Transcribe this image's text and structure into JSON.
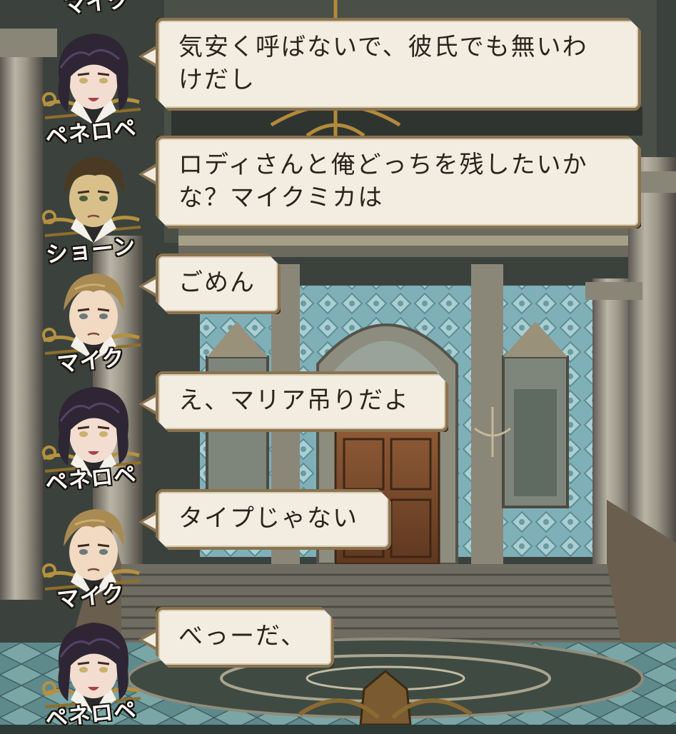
{
  "top_partial_name": "マイク",
  "messages": [
    {
      "speaker": "ペネロペ",
      "character": "penelope",
      "text_lines": [
        "気安く呼ばないで、彼氏でも無いわ",
        "けだし"
      ]
    },
    {
      "speaker": "ショーン",
      "character": "sean",
      "text_lines": [
        "ロディさんと俺どっちを残したいか",
        "な？マイクミカは"
      ]
    },
    {
      "speaker": "マイク",
      "character": "mike",
      "text_lines": [
        "ごめん"
      ]
    },
    {
      "speaker": "ペネロペ",
      "character": "penelope",
      "text_lines": [
        "え、マリア吊りだよ"
      ]
    },
    {
      "speaker": "マイク",
      "character": "mike",
      "text_lines": [
        "タイプじゃない"
      ]
    },
    {
      "speaker": "ペネロペ",
      "character": "penelope",
      "text_lines": [
        "べっーだ、"
      ]
    }
  ],
  "colors": {
    "bubble_fill": "#f3ede1",
    "bubble_border": "#8a7350",
    "text": "#2a241c",
    "wall_teal": "#7fb0b8",
    "stone": "#8d8a80",
    "door_wood": "#7a4a2c"
  }
}
